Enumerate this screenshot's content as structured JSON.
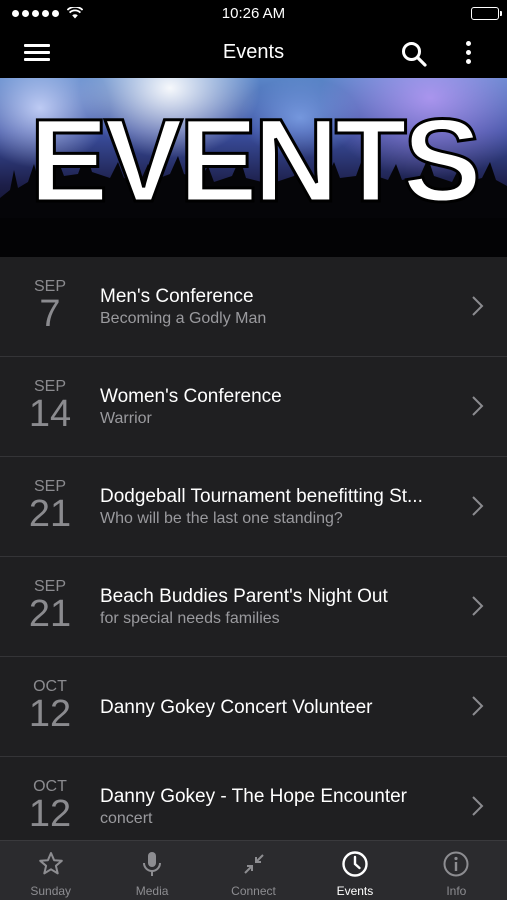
{
  "status_bar": {
    "time": "10:26 AM"
  },
  "nav": {
    "title": "Events"
  },
  "banner": {
    "text": "EVENTS"
  },
  "events": [
    {
      "month": "SEP",
      "day": "7",
      "title": "Men's Conference",
      "subtitle": "Becoming a Godly Man"
    },
    {
      "month": "SEP",
      "day": "14",
      "title": "Women's Conference",
      "subtitle": "Warrior"
    },
    {
      "month": "SEP",
      "day": "21",
      "title": "Dodgeball Tournament benefitting St...",
      "subtitle": "Who will be the last one standing?"
    },
    {
      "month": "SEP",
      "day": "21",
      "title": "Beach Buddies Parent's Night Out",
      "subtitle": "for special needs families"
    },
    {
      "month": "OCT",
      "day": "12",
      "title": "Danny Gokey Concert Volunteer",
      "subtitle": ""
    },
    {
      "month": "OCT",
      "day": "12",
      "title": "Danny Gokey - The Hope Encounter",
      "subtitle": "concert"
    }
  ],
  "tabs": [
    {
      "label": "Sunday",
      "icon": "star-icon",
      "active": false
    },
    {
      "label": "Media",
      "icon": "microphone-icon",
      "active": false
    },
    {
      "label": "Connect",
      "icon": "connect-arrows-icon",
      "active": false
    },
    {
      "label": "Events",
      "icon": "clock-icon",
      "active": true
    },
    {
      "label": "Info",
      "icon": "info-icon",
      "active": false
    }
  ],
  "colors": {
    "accent": "#ffffff",
    "background": "#1f1f21",
    "muted_text": "#8b8b8f"
  }
}
